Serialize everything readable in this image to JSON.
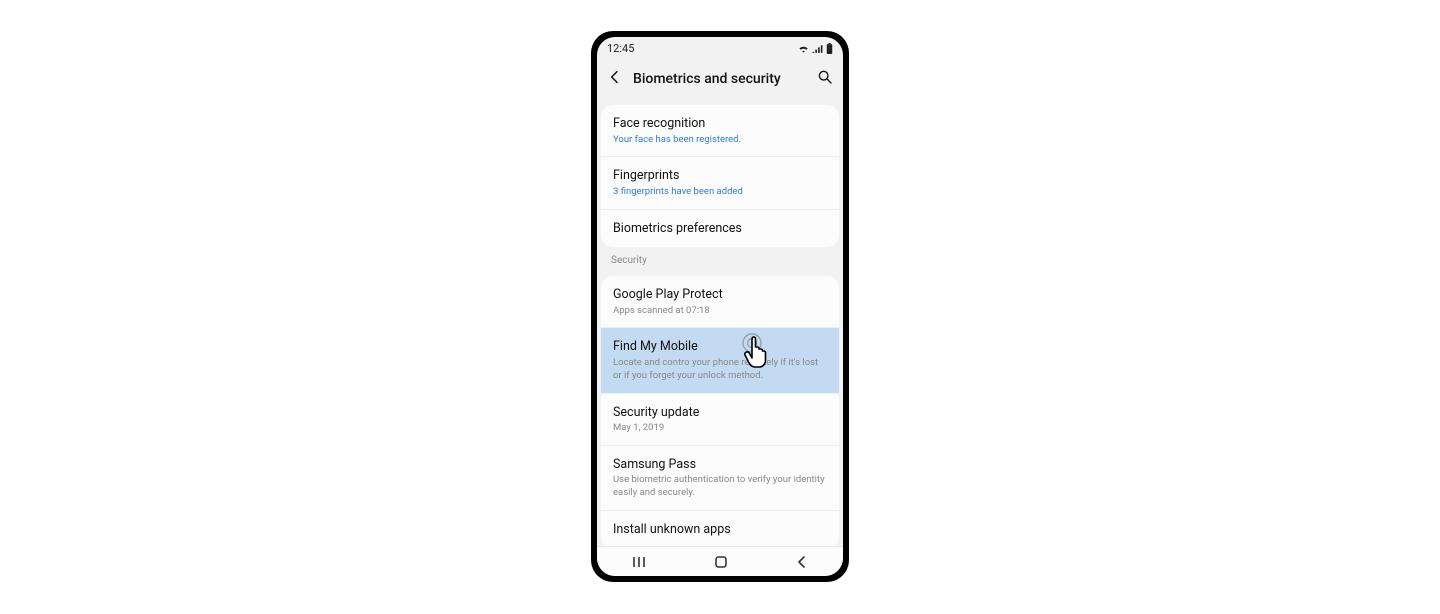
{
  "status": {
    "time": "12:45"
  },
  "header": {
    "title": "Biometrics and security"
  },
  "groups": {
    "biometrics": {
      "face": {
        "title": "Face recognition",
        "sub": "Your face has been registered."
      },
      "fingerprints": {
        "title": "Fingerprints",
        "sub": "3 fingerprints have been added"
      },
      "prefs": {
        "title": "Biometrics preferences"
      }
    },
    "security_header": "Security",
    "security": {
      "play_protect": {
        "title": "Google Play Protect",
        "sub": "Apps scanned at 07:18"
      },
      "find_my_mobile": {
        "title": "Find My Mobile",
        "sub": "Locate and contro your phone remotely if it's lost or if you forget your unlock method."
      },
      "security_update": {
        "title": "Security update",
        "sub": "May 1, 2019"
      },
      "samsung_pass": {
        "title": "Samsung Pass",
        "sub": "Use biometric authentication to verify your identity easily and securely."
      },
      "unknown_apps": {
        "title": "Install unknown apps"
      }
    }
  }
}
